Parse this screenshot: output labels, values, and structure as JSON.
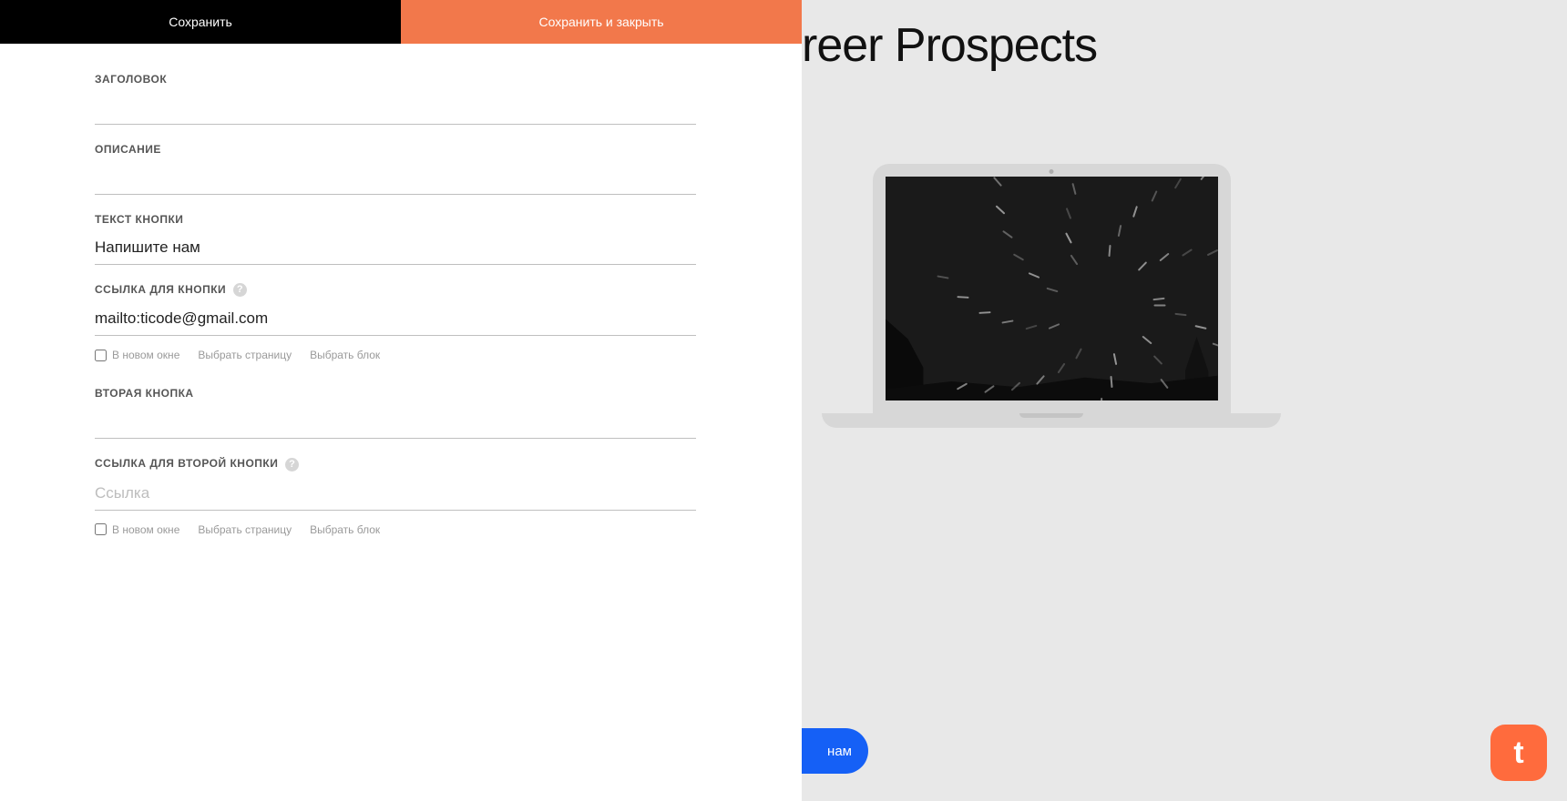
{
  "toolbar": {
    "save": "Сохранить",
    "save_close": "Сохранить и закрыть"
  },
  "labels": {
    "title": "ЗАГОЛОВОК",
    "description": "ОПИСАНИЕ",
    "button_text": "ТЕКСТ КНОПКИ",
    "button_link": "ССЫЛКА ДЛЯ КНОПКИ",
    "second_button": "ВТОРАЯ КНОПКА",
    "second_button_link": "ССЫЛКА ДЛЯ ВТОРОЙ КНОПКИ"
  },
  "values": {
    "title": "",
    "description": "",
    "button_text": "Напишите нам",
    "button_link": "mailto:ticode@gmail.com",
    "second_button": "",
    "second_button_link": ""
  },
  "placeholders": {
    "link": "Ссылка"
  },
  "sub": {
    "new_window": "В новом окне",
    "select_page": "Выбрать страницу",
    "select_block": "Выбрать блок"
  },
  "preview": {
    "title_fragment": "reer Prospects",
    "cta": "нам"
  },
  "help_mark": "?",
  "badge_letter": "t"
}
